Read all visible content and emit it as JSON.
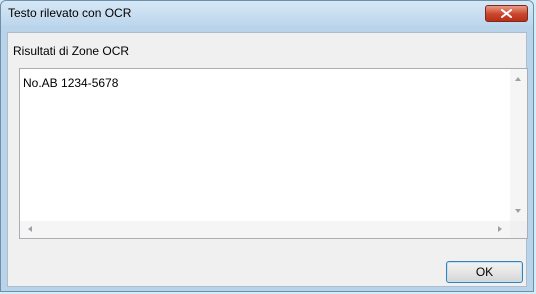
{
  "window": {
    "title": "Testo rilevato con OCR"
  },
  "titlebar": {
    "close_icon": "close-icon"
  },
  "content": {
    "section_label": "Risultati di Zone OCR",
    "ocr_text": "No.AB 1234-5678"
  },
  "buttons": {
    "ok_label": "OK"
  },
  "colors": {
    "close_button": "#c9452c",
    "window_frame": "#b9d4ea",
    "background": "#cfeef5"
  }
}
